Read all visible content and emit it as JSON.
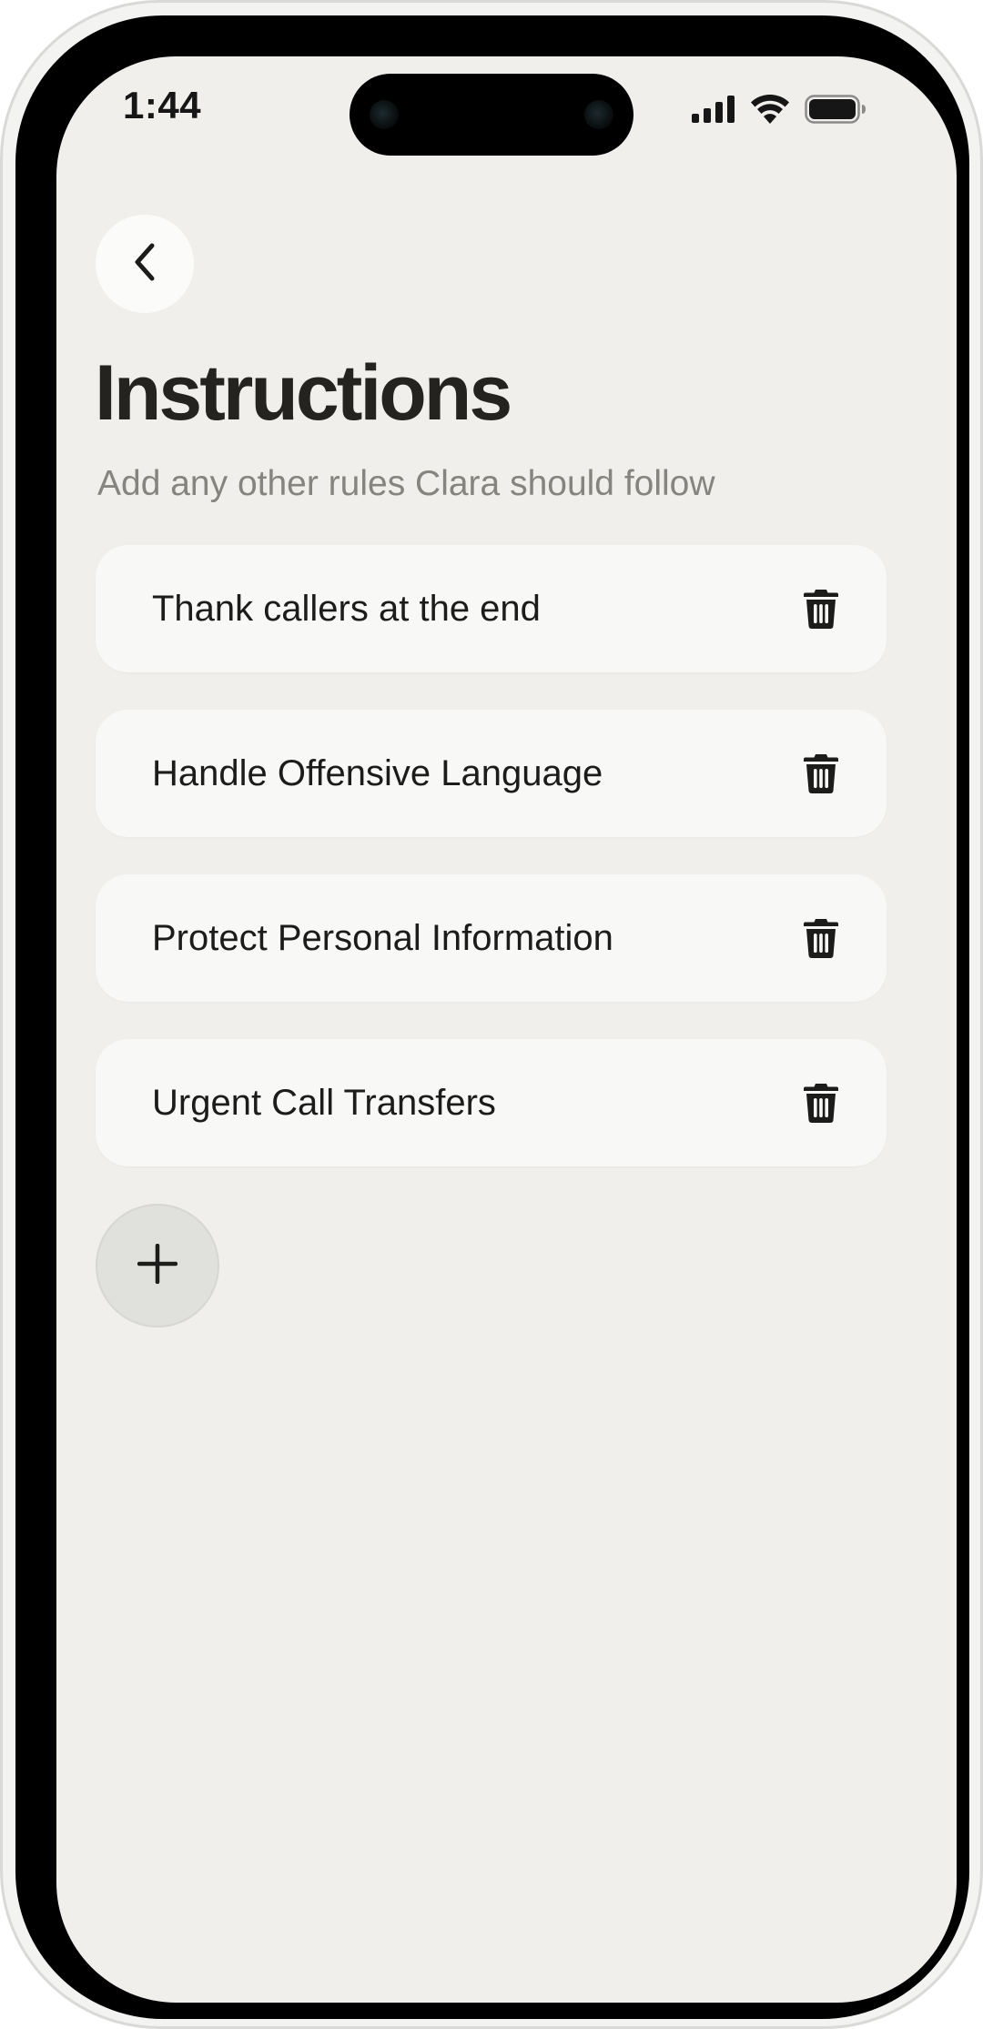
{
  "status_bar": {
    "time": "1:44",
    "icons": [
      "cellular-signal-icon",
      "wifi-icon",
      "battery-icon"
    ]
  },
  "header": {
    "back_icon": "chevron-left-icon",
    "title": "Instructions",
    "subtitle": "Add any other rules Clara should follow"
  },
  "rules": [
    {
      "label": "Thank callers at the end",
      "action_icon": "trash-icon"
    },
    {
      "label": "Handle Offensive Language",
      "action_icon": "trash-icon"
    },
    {
      "label": "Protect Personal Information",
      "action_icon": "trash-icon"
    },
    {
      "label": "Urgent Call Transfers",
      "action_icon": "trash-icon"
    }
  ],
  "add_button": {
    "icon": "plus-icon"
  },
  "colors": {
    "background": "#f0efec",
    "card": "#f8f8f7",
    "title": "#24231f",
    "subtitle": "#86847f",
    "add_button": "#e0e0dd"
  }
}
